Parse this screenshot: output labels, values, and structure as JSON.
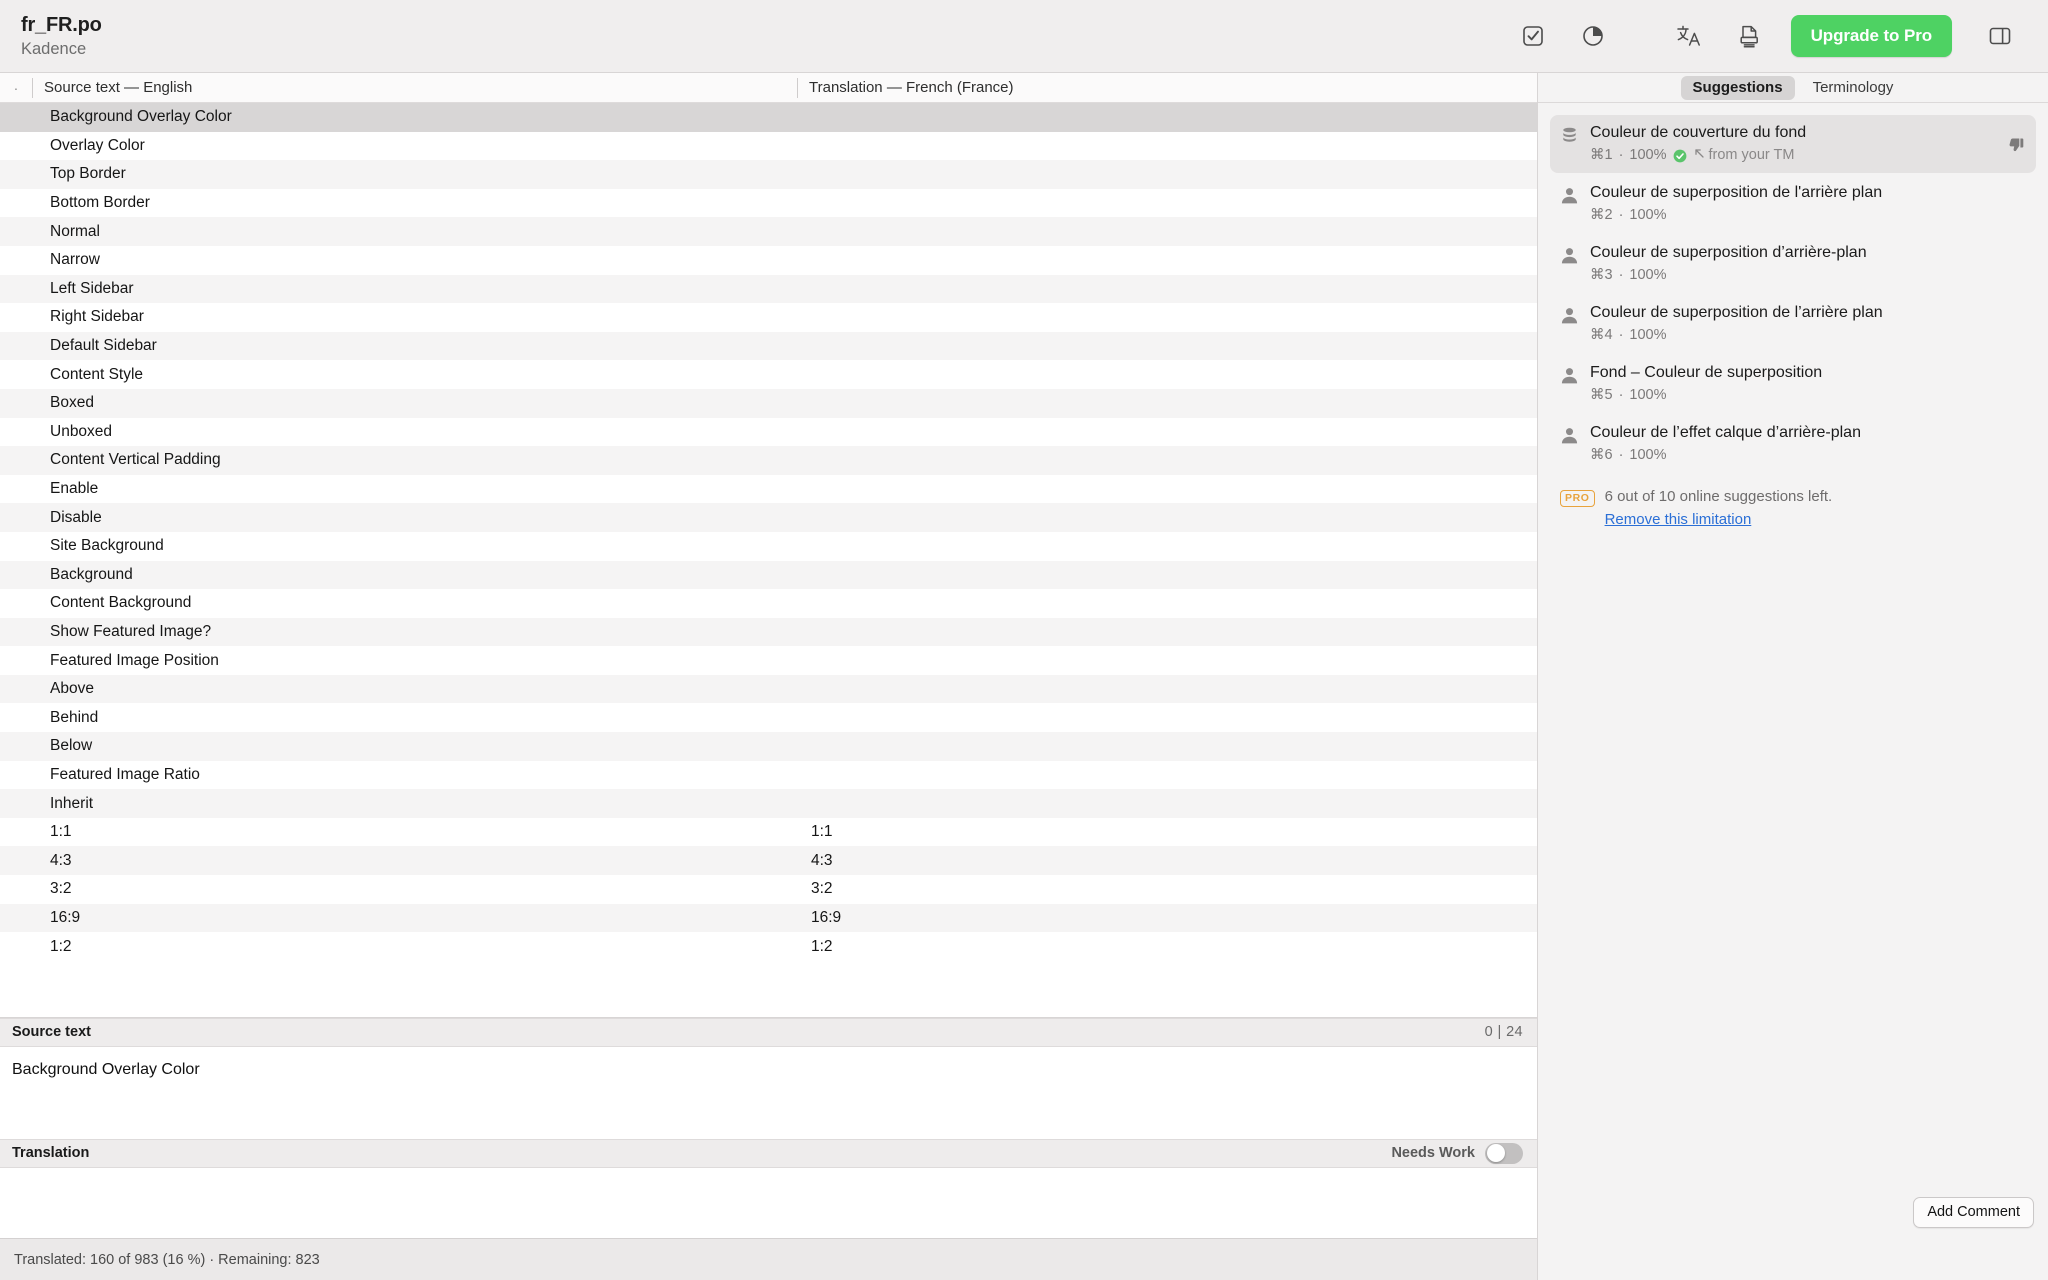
{
  "toolbar": {
    "doc_title": "fr_FR.po",
    "doc_subtitle": "Kadence",
    "icons": [
      {
        "name": "validate-checkbox-icon"
      },
      {
        "name": "statistics-pie-chart-icon"
      },
      {
        "name": "pre-translate-language-icon"
      },
      {
        "name": "export-document-icon"
      },
      {
        "name": "toggle-sidebar-icon"
      }
    ],
    "upgrade_label": "Upgrade to Pro"
  },
  "list": {
    "marker": "·",
    "header_source": "Source text — English",
    "header_translation": "Translation — French (France)",
    "rows": [
      {
        "source": "Background Overlay Color",
        "translation": "",
        "selected": true
      },
      {
        "source": "Overlay Color",
        "translation": ""
      },
      {
        "source": "Top Border",
        "translation": ""
      },
      {
        "source": "Bottom Border",
        "translation": ""
      },
      {
        "source": "Normal",
        "translation": ""
      },
      {
        "source": "Narrow",
        "translation": ""
      },
      {
        "source": "Left Sidebar",
        "translation": ""
      },
      {
        "source": "Right Sidebar",
        "translation": ""
      },
      {
        "source": "Default Sidebar",
        "translation": ""
      },
      {
        "source": "Content Style",
        "translation": ""
      },
      {
        "source": "Boxed",
        "translation": ""
      },
      {
        "source": "Unboxed",
        "translation": ""
      },
      {
        "source": "Content Vertical Padding",
        "translation": ""
      },
      {
        "source": "Enable",
        "translation": ""
      },
      {
        "source": "Disable",
        "translation": ""
      },
      {
        "source": "Site Background",
        "translation": ""
      },
      {
        "source": "Background",
        "translation": ""
      },
      {
        "source": "Content Background",
        "translation": ""
      },
      {
        "source": "Show Featured Image?",
        "translation": ""
      },
      {
        "source": "Featured Image Position",
        "translation": ""
      },
      {
        "source": "Above",
        "translation": ""
      },
      {
        "source": "Behind",
        "translation": ""
      },
      {
        "source": "Below",
        "translation": ""
      },
      {
        "source": "Featured Image Ratio",
        "translation": ""
      },
      {
        "source": "Inherit",
        "translation": ""
      },
      {
        "source": "1:1",
        "translation": "1:1"
      },
      {
        "source": "4:3",
        "translation": "4:3"
      },
      {
        "source": "3:2",
        "translation": "3:2"
      },
      {
        "source": "16:9",
        "translation": "16:9"
      },
      {
        "source": "1:2",
        "translation": "1:2"
      }
    ]
  },
  "editor": {
    "source_label": "Source text",
    "source_value": "Background Overlay Color",
    "char_count": "0 | 24",
    "translation_label": "Translation",
    "translation_value": "",
    "needs_work_label": "Needs Work",
    "needs_work_on": false
  },
  "status": {
    "text": "Translated: 160 of 983 (16 %)  ·  Remaining: 823"
  },
  "sidebar": {
    "tabs": [
      {
        "label": "Suggestions",
        "active": true
      },
      {
        "label": "Terminology",
        "active": false
      }
    ],
    "suggestions": [
      {
        "text": "Couleur de couverture du fond",
        "shortcut": "⌘1",
        "score": "100%",
        "source_note": "from your TM",
        "icon": "tm-database-icon",
        "verified": true,
        "highlight": true,
        "thumbs_down": true
      },
      {
        "text": "Couleur de superposition de l'arrière plan",
        "shortcut": "⌘2",
        "score": "100%",
        "icon": "person-icon"
      },
      {
        "text": "Couleur de superposition d’arrière-plan",
        "shortcut": "⌘3",
        "score": "100%",
        "icon": "person-icon"
      },
      {
        "text": "Couleur de superposition de l’arrière plan",
        "shortcut": "⌘4",
        "score": "100%",
        "icon": "person-icon"
      },
      {
        "text": "Fond – Couleur de superposition",
        "shortcut": "⌘5",
        "score": "100%",
        "icon": "person-icon"
      },
      {
        "text": "Couleur de l’effet calque d’arrière-plan",
        "shortcut": "⌘6",
        "score": "100%",
        "icon": "person-icon"
      }
    ],
    "pro": {
      "badge": "PRO",
      "text": "6 out of 10 online suggestions left.",
      "link": "Remove this limitation"
    },
    "add_comment_label": "Add Comment"
  },
  "colors": {
    "accent_green": "#4ed263",
    "link_blue": "#2b6fd6",
    "pro_orange": "#e8a33d"
  }
}
